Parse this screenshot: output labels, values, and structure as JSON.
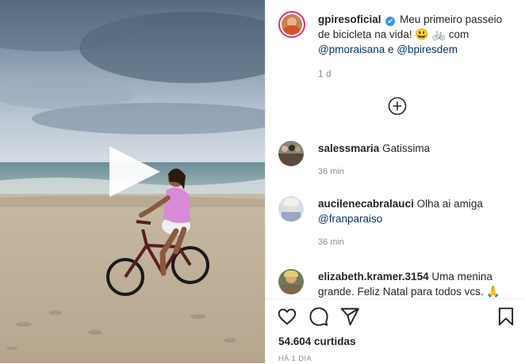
{
  "post": {
    "username": "gpiresoficial",
    "caption_text": "Meu primeiro passeio de bicicleta na vida! ",
    "emoji_smile": "😃",
    "emoji_bike": "🚲",
    "caption_with": " com",
    "mention_1": "@pmoraisana",
    "caption_and": " e ",
    "mention_2": "@bpiresdem",
    "age": "1 d"
  },
  "comments": [
    {
      "username": "salessmaria",
      "text": " Gatissima",
      "mention": "",
      "time": "36 min"
    },
    {
      "username": "aucilenecabralauci",
      "text": " Olha ai amiga ",
      "mention": "@franparaiso",
      "time": "36 min"
    },
    {
      "username": "elizabeth.kramer.3154",
      "text": " Uma menina grande. Feliz Natal para todos vcs. ",
      "mention": "",
      "emoji": "🙏",
      "time": ""
    }
  ],
  "footer": {
    "views": "54.604 curtidas",
    "posted_ago": "HÁ 1 DIA"
  },
  "icons": {
    "verified": "✔",
    "like": "heart-icon",
    "comment": "comment-icon",
    "share": "share-icon",
    "save": "bookmark-icon",
    "load_more": "plus-circle-icon",
    "play": "play-icon"
  },
  "colors": {
    "link": "#00376b",
    "meta": "#8e8e8e",
    "verified": "#3897f0"
  }
}
